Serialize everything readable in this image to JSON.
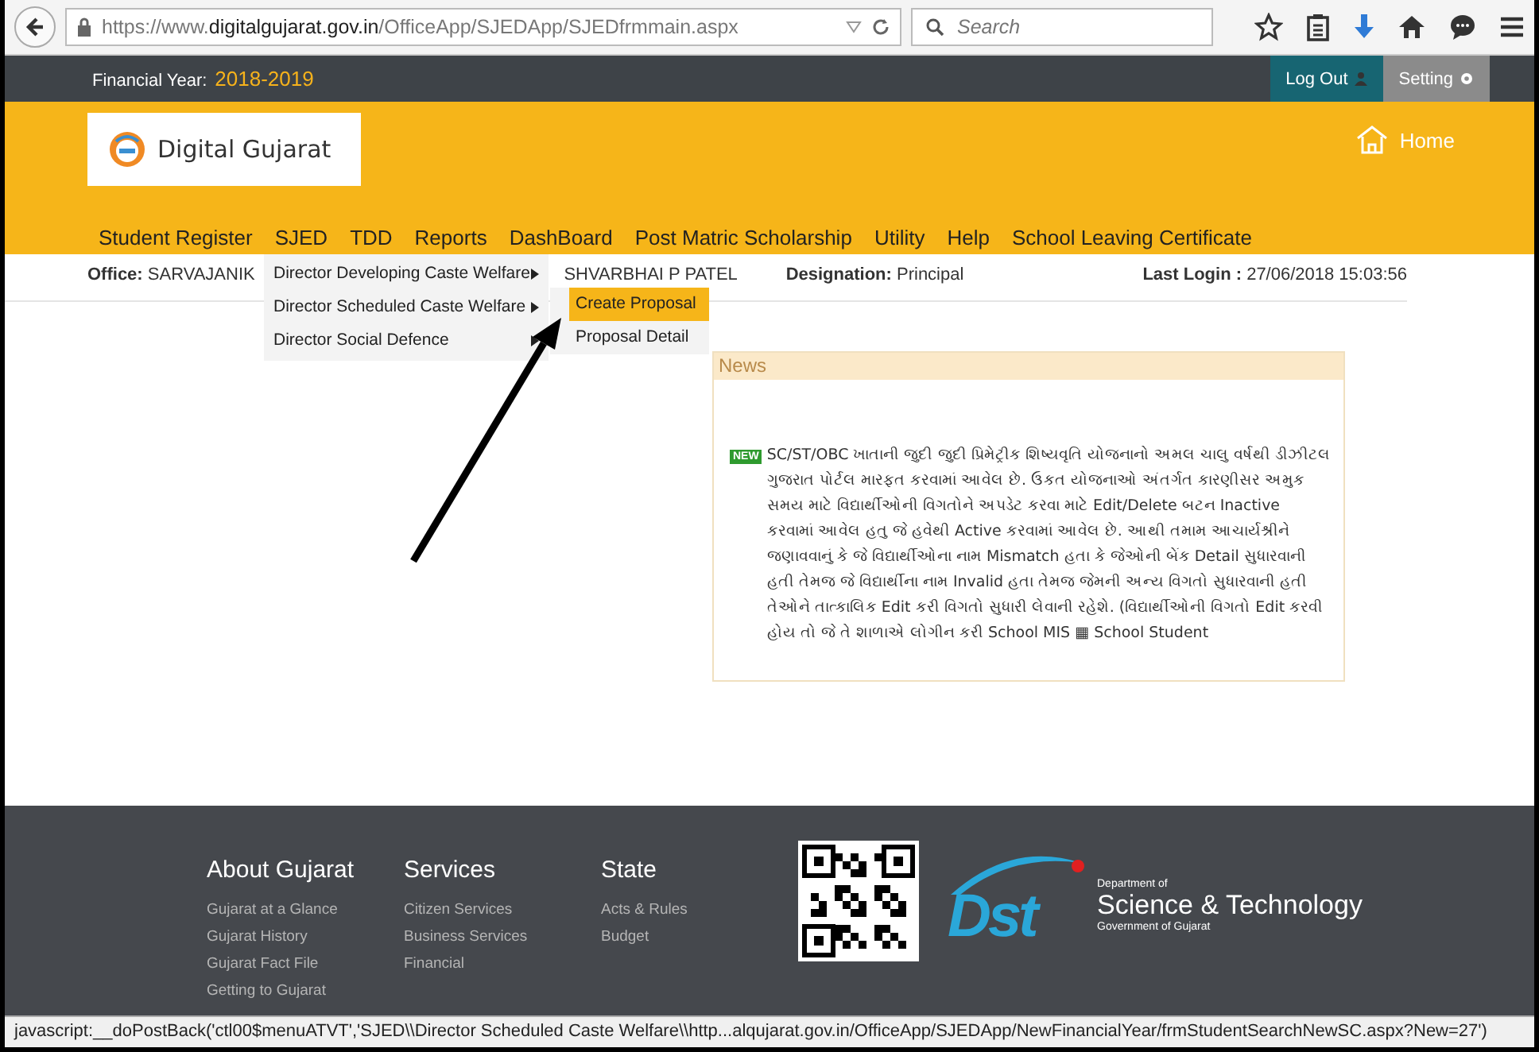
{
  "browser": {
    "url": "https://www.**digitalgujarat.gov.in**/OfficeApp/SJEDApp/SJEDfrmmain.aspx",
    "search": {
      "placeholder": "Search"
    }
  },
  "top_bar": {
    "financial_year_label": "Financial Year:",
    "financial_year": "2018-2019",
    "buttons": [
      {
        "label": "Log Out",
        "kind": "logout"
      },
      {
        "label": "Setting",
        "kind": "setting"
      }
    ]
  },
  "header": {
    "logo": "Digital Gujarat",
    "home": "Home"
  },
  "nav": [
    "Student Register",
    "SJED",
    "TDD",
    "Reports",
    "DashBoard",
    "Post Matric Scholarship",
    "Utility",
    "Help",
    "School Leaving Certificate"
  ],
  "info": {
    "office_label": "Office:",
    "office": "SARVAJANIK",
    "name": "SHVARBHAI P PATEL",
    "designation_label": "Designation:",
    "designation": "Principal",
    "last_login_label": "Last Login :",
    "last_login": "27/06/2018 15:03:56"
  },
  "menu": [
    {
      "label": "Director Developing Caste Welfare"
    },
    {
      "label": "Director Scheduled Caste Welfare"
    },
    {
      "label": "Director Social Defence"
    }
  ],
  "submenu": [
    {
      "label": "Create Proposal",
      "selected": true
    },
    {
      "label": "Proposal Detail",
      "selected": false
    }
  ],
  "news": {
    "title": "News",
    "badge": "NEW",
    "text": "SC/ST/OBC ખાતાની જુદી જુદી પ્રિમેટ્રીક શિષ્યવૃતિ યોજનાનો અમલ ચાલુ વર્ષથી ડીઝીટલ ગુજરાત પોર્ટલ મારફત કરવામાં આવેલ છે. ઉકત યોજનાઓ અંતર્ગત કારણીસર અમુક સમય માટે વિદ્યાર્થીઓની વિગતોને અપડેટ કરવા માટે Edit/Delete બટન Inactive કરવામાં આવેલ હતુ જે હવેથી Active કરવામાં આવેલ છે. આથી તમામ આચાર્યશ્રીને જણાવવાનું કે જે વિદ્યાર્થીઓના નામ Mismatch હતા કે જેઓની બેંક Detail સુધારવાની હતી તેમજ જે વિદ્યાર્થીના નામ Invalid હતા તેમજ જેમની અન્ય વિગતો સુધારવાની હતી તેઓને તાત્કાલિક Edit કરી વિગતો સુધારી લેવાની રહેશે. (વિદ્યાર્થીઓની વિગતો Edit કરવી હોય તો જે તે શાળાએ લોગીન કરી School MIS ▦ School Student"
  },
  "footer": {
    "columns": [
      {
        "title": "About Gujarat",
        "links": [
          "Gujarat at a Glance",
          "Gujarat History",
          "Gujarat Fact File",
          "Getting to Gujarat"
        ]
      },
      {
        "title": "Services",
        "links": [
          "Citizen Services",
          "Business Services",
          "Financial"
        ]
      },
      {
        "title": "State",
        "links": [
          "Acts & Rules",
          "Budget"
        ]
      }
    ],
    "dst": {
      "logo": "Dst",
      "line1": "Department of",
      "line2": "Science & Technology",
      "line3": "Government of Gujarat"
    }
  },
  "status_bar": "javascript:__doPostBack('ctl00$menuATVT','SJED\\\\Director  Scheduled Caste Welfare\\\\http...alqujarat.gov.in/OfficeApp/SJEDApp/NewFinancialYear/frmStudentSearchNewSC.aspx?New=27')"
}
